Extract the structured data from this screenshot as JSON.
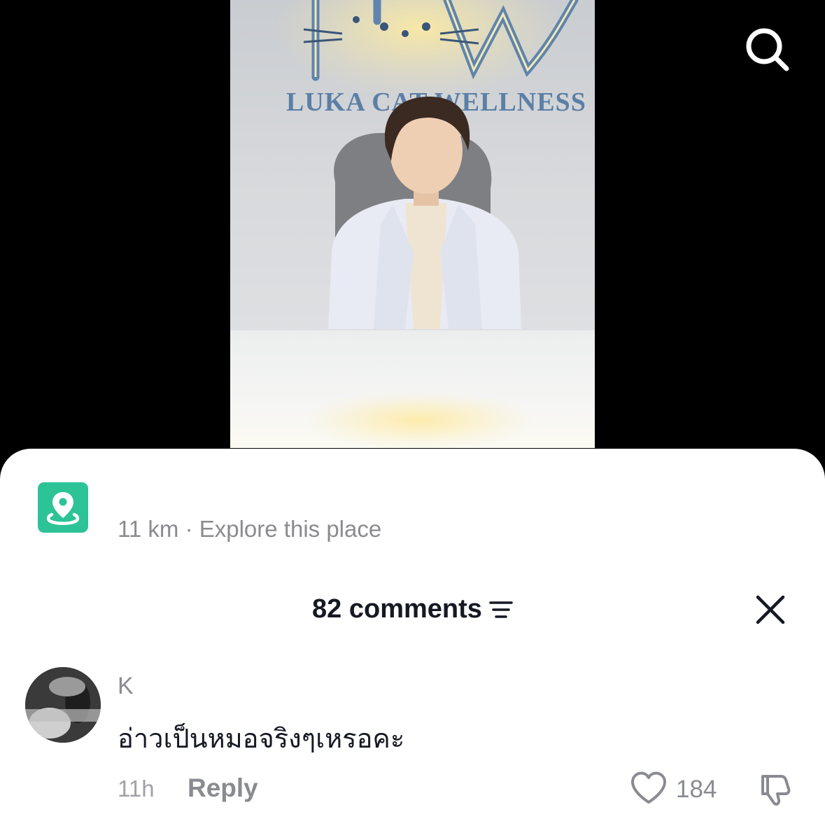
{
  "video": {
    "sign_text": "LUKA CAT WELLNESS"
  },
  "header": {
    "search_icon": "search-icon"
  },
  "place": {
    "icon": "map-pin-icon",
    "icon_color": "#2cc397",
    "meta": "11 km · Explore this place"
  },
  "comments": {
    "title": "82 comments",
    "sort_icon": "sort-filter-icon",
    "close_icon": "close-icon",
    "items": [
      {
        "username": "K",
        "text": "อ่าวเป็นหมอจริงๆเหรอคะ",
        "time": "11h",
        "reply_label": "Reply",
        "likes": "184",
        "like_icon": "heart-outline-icon",
        "dislike_icon": "thumbs-down-icon"
      }
    ]
  },
  "colors": {
    "sheet_background": "#ffffff",
    "primary_text": "#161823",
    "secondary_text": "#8a8b91"
  }
}
